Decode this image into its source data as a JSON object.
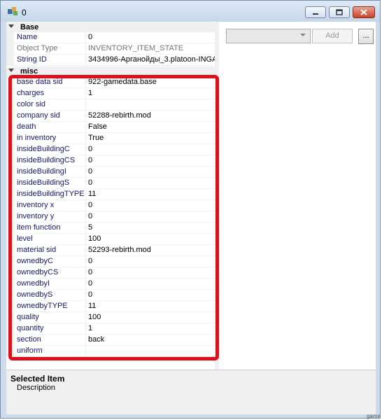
{
  "window": {
    "title": "0"
  },
  "toolbar": {
    "combo_value": "",
    "add_label": "Add",
    "dots_label": "..."
  },
  "grid": {
    "base": {
      "label": "Base",
      "rows": [
        {
          "name": "Name",
          "value": "0",
          "disabled": false
        },
        {
          "name": "Object Type",
          "value": "INVENTORY_ITEM_STATE",
          "disabled": true
        },
        {
          "name": "String ID",
          "value": "3434996-Арганойды_3.platoon-INGA",
          "disabled": false
        }
      ]
    },
    "misc": {
      "label": "misc",
      "rows": [
        {
          "name": "base data sid",
          "value": "922-gamedata.base"
        },
        {
          "name": "charges",
          "value": "1"
        },
        {
          "name": "color sid",
          "value": ""
        },
        {
          "name": "company sid",
          "value": "52288-rebirth.mod"
        },
        {
          "name": "death",
          "value": "False"
        },
        {
          "name": "in inventory",
          "value": "True"
        },
        {
          "name": "insideBuildingC",
          "value": "0"
        },
        {
          "name": "insideBuildingCS",
          "value": "0"
        },
        {
          "name": "insideBuildingI",
          "value": "0"
        },
        {
          "name": "insideBuildingS",
          "value": "0"
        },
        {
          "name": "insideBuildingTYPE",
          "value": "11"
        },
        {
          "name": "inventory x",
          "value": "0"
        },
        {
          "name": "inventory y",
          "value": "0"
        },
        {
          "name": "item function",
          "value": "5"
        },
        {
          "name": "level",
          "value": "100"
        },
        {
          "name": "material sid",
          "value": "52293-rebirth.mod"
        },
        {
          "name": "ownedbyC",
          "value": "0"
        },
        {
          "name": "ownedbyCS",
          "value": "0"
        },
        {
          "name": "ownedbyI",
          "value": "0"
        },
        {
          "name": "ownedbyS",
          "value": "0"
        },
        {
          "name": "ownedbyTYPE",
          "value": "11"
        },
        {
          "name": "quality",
          "value": "100"
        },
        {
          "name": "quantity",
          "value": "1"
        },
        {
          "name": "section",
          "value": "back"
        },
        {
          "name": "uniform",
          "value": ""
        }
      ]
    }
  },
  "help": {
    "title": "Selected Item",
    "description": "Description"
  },
  "watermark": "game",
  "colors": {
    "highlight": "#e0101a",
    "name_text": "#1a1a6e",
    "close_button": "#c7402a"
  },
  "icons": [
    "app-icon",
    "minimize-icon",
    "maximize-icon",
    "close-icon",
    "collapse-triangle-icon",
    "dropdown-arrow-icon"
  ]
}
